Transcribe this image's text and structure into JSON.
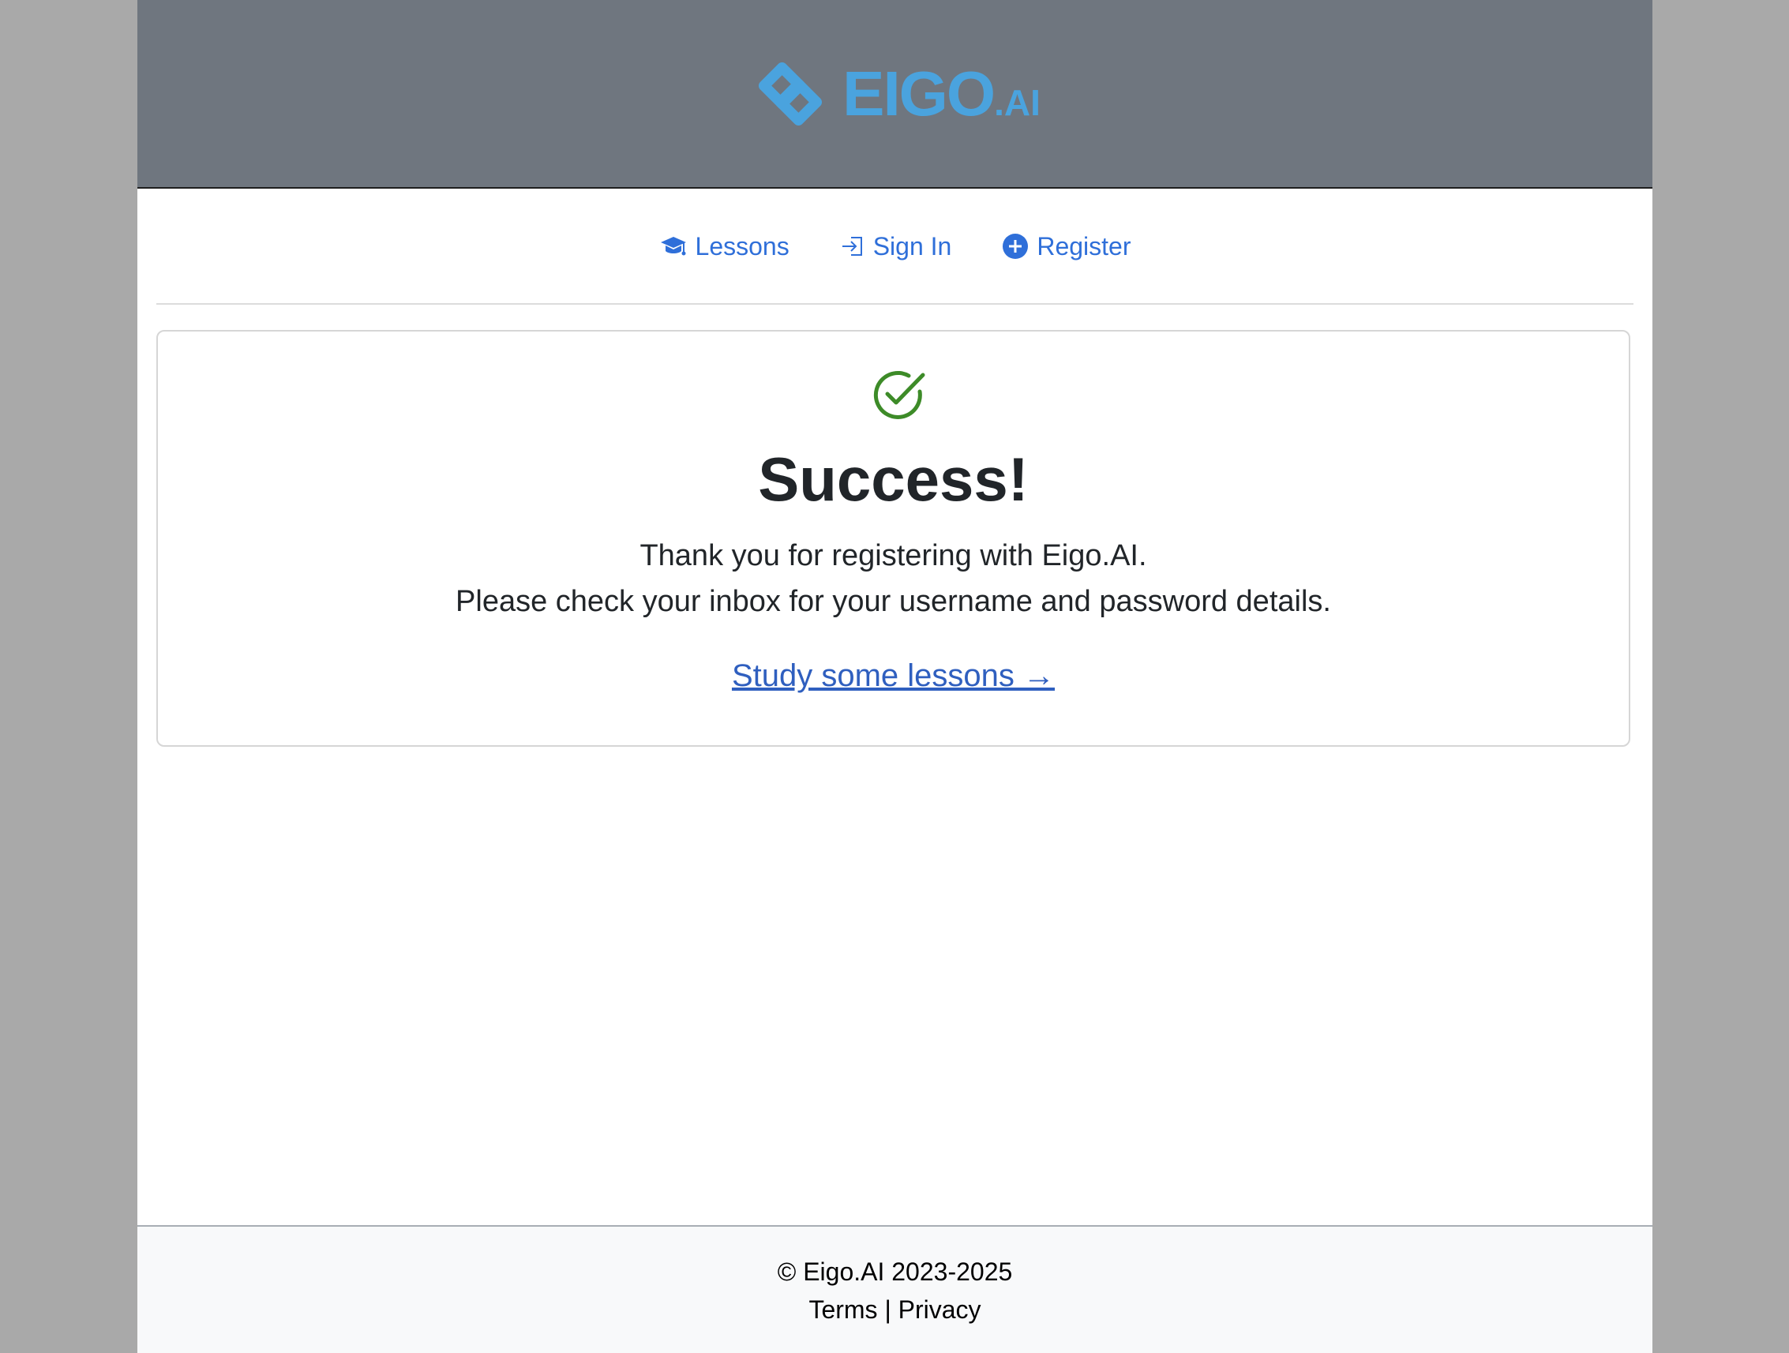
{
  "brand": {
    "name_main": "EIGO",
    "name_suffix": ".AI",
    "color": "#4aa3de",
    "logo_icon": "eigo-logo-icon"
  },
  "nav": {
    "items": [
      {
        "label": "Lessons",
        "icon": "graduation-cap-icon"
      },
      {
        "label": "Sign In",
        "icon": "sign-in-icon"
      },
      {
        "label": "Register",
        "icon": "plus-circle-icon"
      }
    ],
    "link_color": "#2f6fd9"
  },
  "card": {
    "status_icon": "check-circle-icon",
    "status_color": "#3d8b28",
    "title": "Success!",
    "line1": "Thank you for registering with Eigo.AI.",
    "line2": "Please check your inbox for your username and password details.",
    "cta_label": "Study some lessons →"
  },
  "footer": {
    "copyright": "© Eigo.AI 2023-2025",
    "terms_label": "Terms",
    "separator": " | ",
    "privacy_label": "Privacy"
  }
}
